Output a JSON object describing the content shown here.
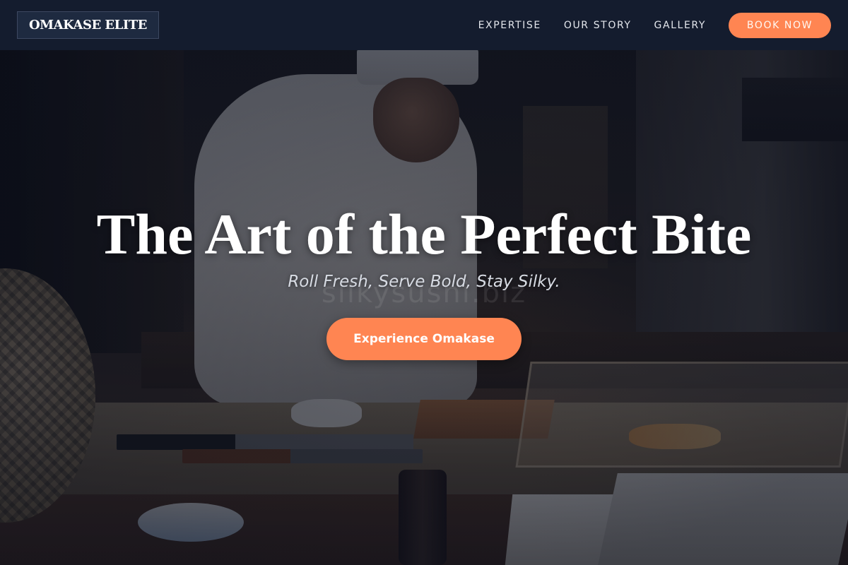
{
  "header": {
    "logo": "OMAKASE ELITE",
    "nav": [
      "EXPERTISE",
      "OUR STORY",
      "GALLERY"
    ],
    "book_label": "BOOK NOW"
  },
  "hero": {
    "title": "The Art of the Perfect Bite",
    "tagline": "Roll Fresh, Serve Bold, Stay Silky.",
    "watermark": "silkysushi.biz",
    "cta_label": "Experience Omakase"
  },
  "colors": {
    "accent": "#ff8552",
    "header_bg": "#141c2e"
  }
}
